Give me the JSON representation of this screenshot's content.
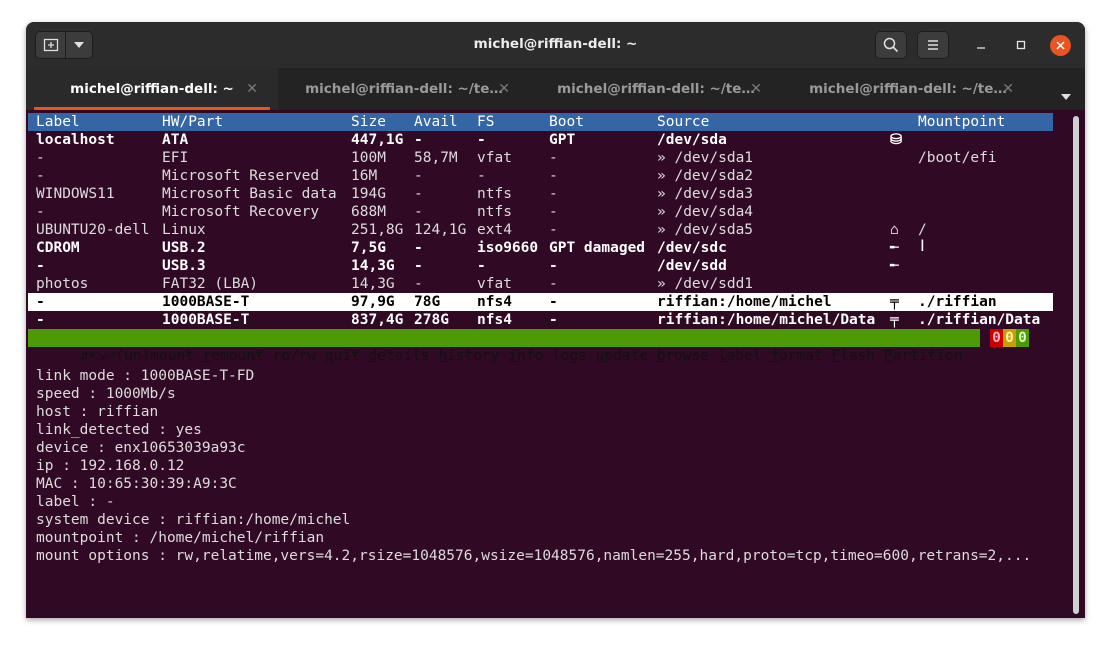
{
  "window": {
    "title": "michel@riffian-dell: ~"
  },
  "tabs": [
    {
      "label": "michel@riffian-dell: ~",
      "active": true
    },
    {
      "label": "michel@riffian-dell: ~/te…",
      "active": false
    },
    {
      "label": "michel@riffian-dell: ~/te…",
      "active": false
    },
    {
      "label": "michel@riffian-dell: ~/te…",
      "active": false
    }
  ],
  "table": {
    "headers": [
      "Label",
      "HW/Part",
      "Size",
      "Avail",
      "FS",
      "Boot",
      "Source",
      "",
      "Mountpoint"
    ],
    "rows": [
      {
        "style": "bold",
        "cells": [
          "localhost",
          "ATA",
          "447,1G",
          "-",
          "-",
          "GPT",
          "/dev/sda",
          "⛁",
          ""
        ]
      },
      {
        "style": "normal",
        "cells": [
          "-",
          "EFI",
          "100M",
          "58,7M",
          "vfat",
          "-",
          "» /dev/sda1",
          "",
          "/boot/efi"
        ]
      },
      {
        "style": "normal",
        "cells": [
          "-",
          "Microsoft Reserved",
          "16M",
          "-",
          "-",
          "-",
          "» /dev/sda2",
          "",
          ""
        ]
      },
      {
        "style": "normal",
        "cells": [
          "WINDOWS11",
          "Microsoft Basic data",
          "194G",
          "-",
          "ntfs",
          "-",
          "» /dev/sda3",
          "",
          ""
        ]
      },
      {
        "style": "normal",
        "cells": [
          "-",
          "Microsoft Recovery",
          "688M",
          "-",
          "ntfs",
          "-",
          "» /dev/sda4",
          "",
          ""
        ]
      },
      {
        "style": "normal",
        "cells": [
          "UBUNTU20-dell",
          "Linux",
          "251,8G",
          "124,1G",
          "ext4",
          "-",
          "» /dev/sda5",
          "⌂",
          "/"
        ]
      },
      {
        "style": "bold",
        "cells": [
          "CDROM",
          "USB.2",
          "7,5G",
          "-",
          "iso9660",
          "GPT damaged",
          "/dev/sdc",
          "╾",
          ""
        ]
      },
      {
        "style": "bold",
        "cells": [
          "-",
          "USB.3",
          "14,3G",
          "-",
          "-",
          "-",
          "/dev/sdd",
          "╾",
          ""
        ]
      },
      {
        "style": "normal",
        "cells": [
          "photos",
          "FAT32 (LBA)",
          "14,3G",
          "-",
          "vfat",
          "-",
          "» /dev/sdd1",
          "",
          ""
        ]
      },
      {
        "style": "selected",
        "cells": [
          "-",
          "1000BASE-T",
          "97,9G",
          "78G",
          "nfs4",
          "-",
          "riffian:/home/michel",
          "╤",
          "./riffian"
        ]
      },
      {
        "style": "bold",
        "cells": [
          "-",
          "1000BASE-T",
          "837,4G",
          "278G",
          "nfs4",
          "-",
          "riffian:/home/michel/Data",
          "╤",
          "./riffian/Data"
        ]
      }
    ]
  },
  "statusbar": {
    "arrows": "⇵⇱⇲⏎",
    "items": [
      {
        "key": "",
        "rest": "(un)mount"
      },
      {
        "key": "r",
        "rest": "emount"
      },
      {
        "key": "",
        "rest": "ro/rw"
      },
      {
        "key": "q",
        "rest": "uit"
      },
      {
        "key": "d",
        "rest": "etails"
      },
      {
        "key": "h",
        "rest": "istory"
      },
      {
        "key": "i",
        "rest": "nfo"
      },
      {
        "key": "",
        "rest": "logs"
      },
      {
        "key": "u",
        "rest": "pdate"
      },
      {
        "key": "b",
        "rest": "rowse"
      },
      {
        "key": "l",
        "rest": "abel"
      },
      {
        "key": "f",
        "rest": "ormat"
      },
      {
        "key": "F",
        "rest": "lash"
      },
      {
        "key": "P",
        "rest": "artition"
      }
    ],
    "counts": [
      {
        "value": "0",
        "bg": "#cc0000",
        "fg": "#ffb3b3"
      },
      {
        "value": "0",
        "bg": "#c4a000",
        "fg": "#fff2a8"
      },
      {
        "value": "0",
        "bg": "#4e9a06",
        "fg": "#d9ffb0"
      }
    ]
  },
  "details": [
    "link mode : 1000BASE-T-FD",
    "speed : 1000Mb/s",
    "host : riffian",
    "link_detected : yes",
    "device : enx10653039a93c",
    "ip : 192.168.0.12",
    "MAC : 10:65:30:39:A9:3C",
    "label : -",
    "system device : riffian:/home/michel",
    "mountpoint : /home/michel/riffian",
    "mount options : rw,relatime,vers=4.2,rsize=1048576,wsize=1048576,namlen=255,hard,proto=tcp,timeo=600,retrans=2,..."
  ],
  "colors": {
    "terminal_bg": "#300a24",
    "header_bg": "#3465a4",
    "statusbar_bg": "#4e9a06",
    "accent": "#e95420"
  }
}
